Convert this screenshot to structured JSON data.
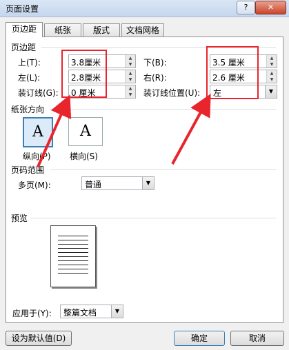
{
  "window": {
    "title": "页面设置",
    "help_btn": "?",
    "close_btn": "✕"
  },
  "tabs": [
    "页边距",
    "纸张",
    "版式",
    "文档网格"
  ],
  "margins": {
    "section": "页边距",
    "top_label": "上(T):",
    "top_value": "3.8厘米",
    "bottom_label": "下(B):",
    "bottom_value": "3.5 厘米",
    "left_label": "左(L):",
    "left_value": "2.8厘米",
    "right_label": "右(R):",
    "right_value": "2.6 厘米",
    "gutter_label": "装订线(G):",
    "gutter_value": "0 厘米",
    "gutter_pos_label": "装订线位置(U):",
    "gutter_pos_value": "左"
  },
  "orientation": {
    "section": "纸张方向",
    "portrait_icon": "A",
    "portrait_label": "纵向(P)",
    "landscape_icon": "A",
    "landscape_label": "横向(S)"
  },
  "pages": {
    "section": "页码范围",
    "multi_label": "多页(M):",
    "multi_value": "普通"
  },
  "preview": {
    "section": "预览",
    "apply_label": "应用于(Y):",
    "apply_value": "整篇文档"
  },
  "buttons": {
    "set_default": "设为默认值(D)",
    "ok": "确定",
    "cancel": "取消"
  },
  "annotation_color": "#e8242d"
}
